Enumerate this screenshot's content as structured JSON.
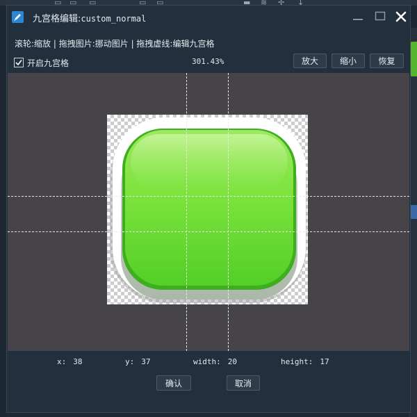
{
  "window": {
    "title_prefix": "九宫格编辑:",
    "title_name": "custom_normal"
  },
  "hint": "滚轮:缩放 | 拖拽图片:挪动图片 | 拖拽虚线:编辑九宫格",
  "nine_slice": {
    "checkbox_label": "开启九宫格",
    "checked": true
  },
  "zoom_percent": "301.43%",
  "toolbar": {
    "zoom_in": "放大",
    "zoom_out": "缩小",
    "reset": "恢复"
  },
  "stats": {
    "x_label": "x:",
    "x_value": "38",
    "y_label": "y:",
    "y_value": "37",
    "width_label": "width:",
    "width_value": "20",
    "height_label": "height:",
    "height_value": "17"
  },
  "actions": {
    "confirm": "确认",
    "cancel": "取消"
  },
  "colors": {
    "dialog_bg": "#22303d",
    "canvas_bg": "#464448",
    "button_green_top": "#9be960",
    "button_green_bottom": "#52cf28",
    "accent_blue": "#2b86d6"
  },
  "icons": {
    "app": "edit-pencil-icon",
    "minimize": "minimize-icon",
    "maximize": "maximize-icon",
    "close": "close-icon",
    "check": "checkmark-icon"
  }
}
